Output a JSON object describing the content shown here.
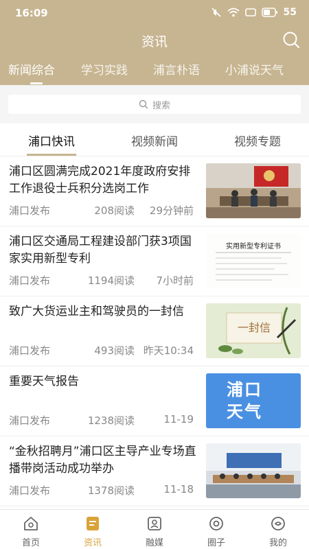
{
  "status_bar": {
    "time": "16:09",
    "battery": "55"
  },
  "header": {
    "title": "资讯"
  },
  "top_tabs": [
    "新闻综合",
    "学习实践",
    "浦言朴语",
    "小浦说天气"
  ],
  "search": {
    "placeholder": "搜索"
  },
  "sub_tabs": [
    "浦口快讯",
    "视频新闻",
    "视频专题"
  ],
  "news": [
    {
      "title": "浦口区圆满完成2021年度政府安排工作退役士兵积分选岗工作",
      "source": "浦口发布",
      "reads": "208阅读",
      "time": "29分钟前",
      "thumb_text": ""
    },
    {
      "title": "浦口区交通局工程建设部门获3项国家实用新型专利",
      "source": "浦口发布",
      "reads": "1194阅读",
      "time": "7小时前",
      "thumb_text": "实用新型专利证书"
    },
    {
      "title": "致广大货运业主和驾驶员的一封信",
      "source": "浦口发布",
      "reads": "493阅读",
      "time": "昨天10:34",
      "thumb_text": "一封信"
    },
    {
      "title": "重要天气报告",
      "source": "浦口发布",
      "reads": "1238阅读",
      "time": "11-19",
      "thumb_text": "浦口天气"
    },
    {
      "title": "“金秋招聘月”浦口区主导产业专场直播带岗活动成功举办",
      "source": "浦口发布",
      "reads": "1378阅读",
      "time": "11-18",
      "thumb_text": ""
    }
  ],
  "bottom_nav": [
    "首页",
    "资讯",
    "融媒",
    "圈子",
    "我的"
  ],
  "colors": {
    "header_bg": "#c7b591",
    "active_nav": "#d9a33a",
    "accent": "#c7b591"
  }
}
